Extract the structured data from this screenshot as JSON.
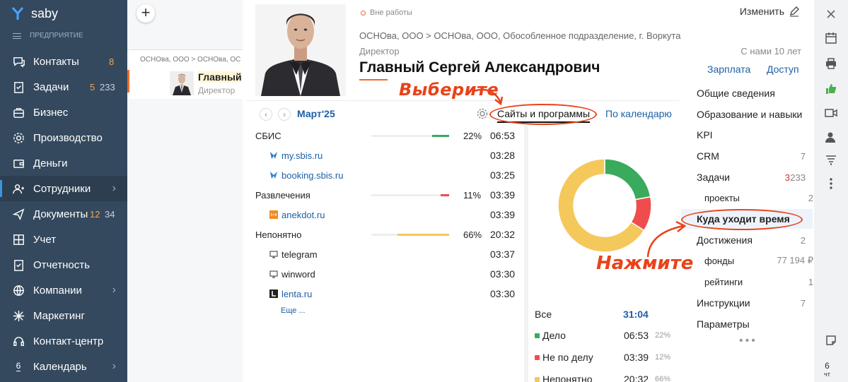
{
  "app": {
    "brand": "saby",
    "section": "ПРЕДПРИЯТИЕ"
  },
  "sidebar": {
    "items": [
      {
        "label": "Контакты",
        "count1": "8",
        "count2": ""
      },
      {
        "label": "Задачи",
        "count1": "5",
        "count2": "233"
      },
      {
        "label": "Бизнес",
        "count1": "",
        "count2": ""
      },
      {
        "label": "Производство",
        "count1": "",
        "count2": ""
      },
      {
        "label": "Деньги",
        "count1": "",
        "count2": ""
      },
      {
        "label": "Сотрудники",
        "count1": "",
        "count2": ""
      },
      {
        "label": "Документы",
        "count1": "12",
        "count2": "34"
      },
      {
        "label": "Учет",
        "count1": "",
        "count2": ""
      },
      {
        "label": "Отчетность",
        "count1": "",
        "count2": ""
      },
      {
        "label": "Компании",
        "count1": "",
        "count2": ""
      },
      {
        "label": "Маркетинг",
        "count1": "",
        "count2": ""
      },
      {
        "label": "Контакт-центр",
        "count1": "",
        "count2": ""
      },
      {
        "label": "Календарь",
        "count1": "",
        "count2": "",
        "day": "6"
      }
    ]
  },
  "list": {
    "add_label": "+",
    "row": {
      "crumb": "ОСНОва, ООО > ОСНОва, ОС",
      "name": "Главный",
      "role": "Директор"
    }
  },
  "profile": {
    "status": "Вне работы",
    "edit_label": "Изменить",
    "org_path": "ОСНОва, ООО > ОСНОва, ООО, Обособленное подразделение, г. Воркута",
    "role": "Директор",
    "since": "С нами 10 лет",
    "full_name": "Главный Сергей Александрович",
    "link_salary": "Зарплата",
    "link_access": "Доступ"
  },
  "timepanel": {
    "month": "Март'25",
    "tab_sites": "Сайты и программы",
    "tab_calendar": "По календарю",
    "callout_select": "Выберите",
    "callout_click": "Нажмите",
    "more_label": "Еще ...",
    "rows": [
      {
        "name": "СБИС",
        "pct": "22%",
        "time": "06:53",
        "bar": 0.22,
        "color": "#3aaa5c",
        "type": "group"
      },
      {
        "name": "my.sbis.ru",
        "time": "03:28",
        "type": "sub",
        "icon": "sbis-bird-icon"
      },
      {
        "name": "booking.sbis.ru",
        "time": "03:25",
        "type": "sub",
        "icon": "sbis-bird-icon"
      },
      {
        "name": "Развлечения",
        "pct": "11%",
        "time": "03:39",
        "bar": 0.11,
        "color": "#ef4d4d",
        "type": "group"
      },
      {
        "name": "anekdot.ru",
        "time": "03:39",
        "type": "sub",
        "icon": "anekdot-icon"
      },
      {
        "name": "Непонятно",
        "pct": "66%",
        "time": "20:32",
        "bar": 0.66,
        "color": "#f5c85b",
        "type": "group"
      },
      {
        "name": "telegram",
        "time": "03:37",
        "type": "sub",
        "icon": "monitor-icon",
        "dark": true
      },
      {
        "name": "winword",
        "time": "03:30",
        "type": "sub",
        "icon": "monitor-icon",
        "dark": true
      },
      {
        "name": "lenta.ru",
        "time": "03:30",
        "type": "sub",
        "icon": "lenta-icon"
      }
    ]
  },
  "chart_data": {
    "type": "pie",
    "categories": [
      "Дело",
      "Не по делу",
      "Непонятно"
    ],
    "values": [
      22,
      12,
      66
    ],
    "times": [
      "06:53",
      "03:39",
      "20:32"
    ],
    "percents": [
      "22%",
      "12%",
      "66%"
    ],
    "colors": [
      "#3aaa5c",
      "#ef4d4d",
      "#f5c85b"
    ],
    "total_label": "Все",
    "total_value": "31:04"
  },
  "menu": {
    "items": [
      {
        "label": "Общие сведения",
        "badge": ""
      },
      {
        "label": "Образование и навыки",
        "badge": ""
      },
      {
        "label": "KPI",
        "badge": ""
      },
      {
        "label": "CRM",
        "badge": "7"
      },
      {
        "label": "Задачи",
        "badge_red": "3",
        "badge": "233"
      },
      {
        "label": "проекты",
        "badge": "2",
        "sub": true
      },
      {
        "label": "Куда уходит время",
        "badge": "",
        "active": true
      },
      {
        "label": "Достижения",
        "badge": "2"
      },
      {
        "label": "фонды",
        "badge": "77 194 ₽",
        "sub": true
      },
      {
        "label": "рейтинги",
        "badge": "1",
        "sub": true
      },
      {
        "label": "Инструкции",
        "badge": "7"
      },
      {
        "label": "Параметры",
        "badge": ""
      }
    ],
    "more": "•••"
  },
  "toolbar": {
    "today_day": "6",
    "today_weekday": "чт"
  }
}
